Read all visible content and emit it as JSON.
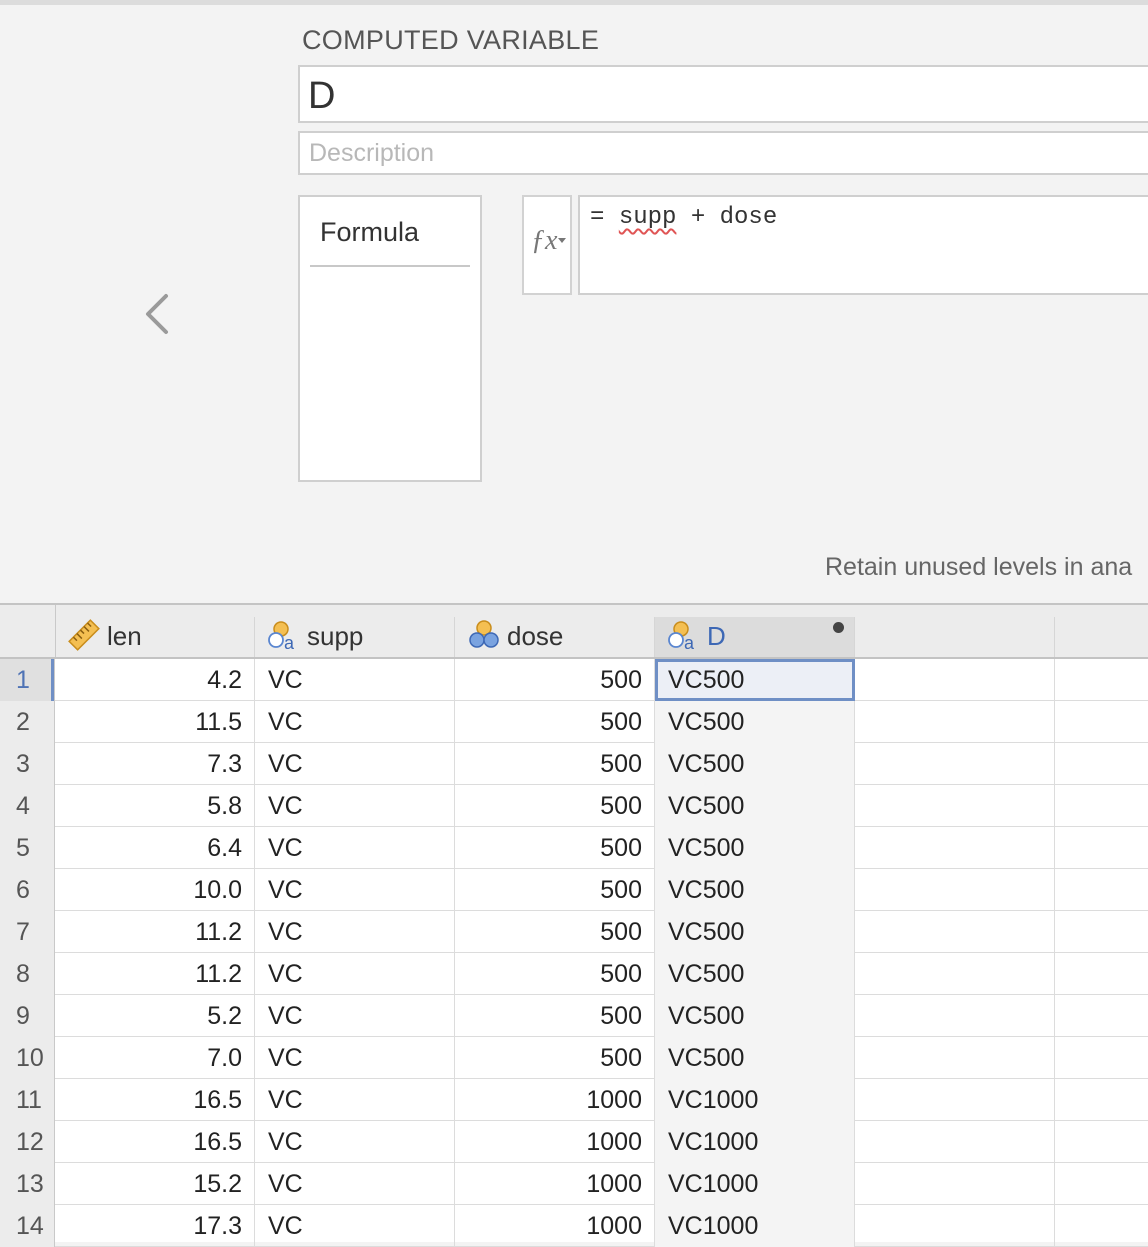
{
  "setup": {
    "title": "COMPUTED VARIABLE",
    "name_value": "D",
    "description_placeholder": "Description",
    "formula_tab_label": "Formula",
    "fx_icon": "fx",
    "formula_prefix": "= ",
    "formula_token_1": "supp",
    "formula_rest": " + dose",
    "retain_levels_label": "Retain unused levels in ana"
  },
  "columns": [
    {
      "name": "len",
      "icon": "ruler-icon",
      "measure": "continuous"
    },
    {
      "name": "supp",
      "icon": "nominal-text-icon",
      "measure": "nominal text"
    },
    {
      "name": "dose",
      "icon": "nominal-icon",
      "measure": "nominal"
    },
    {
      "name": "D",
      "icon": "nominal-text-icon",
      "measure": "nominal text",
      "selected": true
    }
  ],
  "rows": [
    {
      "n": "1",
      "len": "4.2",
      "supp": "VC",
      "dose": "500",
      "D": "VC500"
    },
    {
      "n": "2",
      "len": "11.5",
      "supp": "VC",
      "dose": "500",
      "D": "VC500"
    },
    {
      "n": "3",
      "len": "7.3",
      "supp": "VC",
      "dose": "500",
      "D": "VC500"
    },
    {
      "n": "4",
      "len": "5.8",
      "supp": "VC",
      "dose": "500",
      "D": "VC500"
    },
    {
      "n": "5",
      "len": "6.4",
      "supp": "VC",
      "dose": "500",
      "D": "VC500"
    },
    {
      "n": "6",
      "len": "10.0",
      "supp": "VC",
      "dose": "500",
      "D": "VC500"
    },
    {
      "n": "7",
      "len": "11.2",
      "supp": "VC",
      "dose": "500",
      "D": "VC500"
    },
    {
      "n": "8",
      "len": "11.2",
      "supp": "VC",
      "dose": "500",
      "D": "VC500"
    },
    {
      "n": "9",
      "len": "5.2",
      "supp": "VC",
      "dose": "500",
      "D": "VC500"
    },
    {
      "n": "10",
      "len": "7.0",
      "supp": "VC",
      "dose": "500",
      "D": "VC500"
    },
    {
      "n": "11",
      "len": "16.5",
      "supp": "VC",
      "dose": "1000",
      "D": "VC1000"
    },
    {
      "n": "12",
      "len": "16.5",
      "supp": "VC",
      "dose": "1000",
      "D": "VC1000"
    },
    {
      "n": "13",
      "len": "15.2",
      "supp": "VC",
      "dose": "1000",
      "D": "VC1000"
    },
    {
      "n": "14",
      "len": "17.3",
      "supp": "VC",
      "dose": "1000",
      "D": "VC1000"
    }
  ],
  "colors": {
    "accent": "#3d68b5",
    "selection_border": "#6f8fc5",
    "nominal_orange": "#f0b443",
    "nominal_blue": "#5a86d0"
  }
}
